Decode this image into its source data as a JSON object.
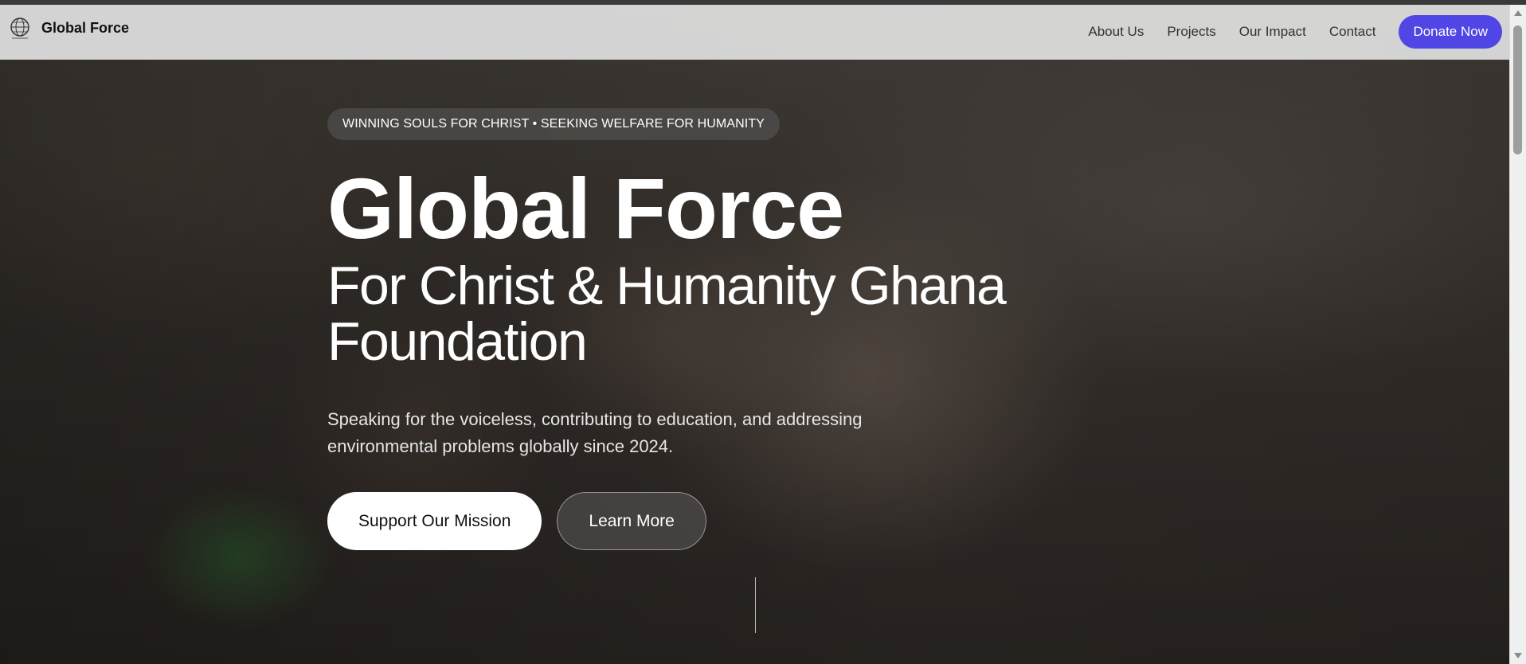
{
  "brand": {
    "name": "Global Force",
    "logo_icon": "globe-cross-icon"
  },
  "nav": {
    "items": [
      {
        "label": "About Us"
      },
      {
        "label": "Projects"
      },
      {
        "label": "Our Impact"
      },
      {
        "label": "Contact"
      }
    ],
    "donate_label": "Donate Now"
  },
  "hero": {
    "tagline": "WINNING SOULS FOR CHRIST • SEEKING WELFARE FOR HUMANITY",
    "title": "Global Force",
    "subtitle": "For Christ & Humanity Ghana Foundation",
    "description": "Speaking for the voiceless, contributing to education, and addressing environmental problems globally since 2024.",
    "primary_cta": "Support Our Mission",
    "secondary_cta": "Learn More"
  },
  "colors": {
    "accent": "#4f46e5",
    "navbar_bg": "#dcdcdc"
  }
}
